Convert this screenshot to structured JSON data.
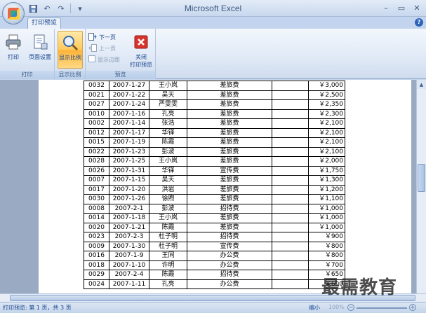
{
  "window": {
    "title": "Microsoft Excel",
    "controls": [
      "–",
      "▭",
      "✕"
    ]
  },
  "tabs": {
    "active": "打印预览",
    "help": "?"
  },
  "ribbon": {
    "groups": [
      {
        "label": "打印",
        "buttons": [
          "打印",
          "页面设置"
        ]
      },
      {
        "label": "显示比例",
        "buttons": [
          "显示比例"
        ]
      },
      {
        "label": "预览",
        "small_buttons": [
          "下一页",
          "上一页",
          "显示边距"
        ],
        "big_button": "关闭\n打印预览"
      }
    ],
    "close_line1": "关闭",
    "close_line2": "打印预览"
  },
  "table": {
    "rows": [
      [
        "0032",
        "2007-1-27",
        "王小岚",
        "差旅费",
        "",
        "￥3,000"
      ],
      [
        "0021",
        "2007-1-22",
        "吴天",
        "差旅费",
        "",
        "￥2,500"
      ],
      [
        "0027",
        "2007-1-24",
        "严雯雯",
        "差旅费",
        "",
        "￥2,350"
      ],
      [
        "0010",
        "2007-1-16",
        "孔亮",
        "差旅费",
        "",
        "￥2,300"
      ],
      [
        "0002",
        "2007-1-14",
        "张浩",
        "差旅费",
        "",
        "￥2,100"
      ],
      [
        "0012",
        "2007-1-17",
        "华铎",
        "差旅费",
        "",
        "￥2,100"
      ],
      [
        "0015",
        "2007-1-19",
        "陈霞",
        "差旅费",
        "",
        "￥2,100"
      ],
      [
        "0022",
        "2007-1-23",
        "彭波",
        "差旅费",
        "",
        "￥2,100"
      ],
      [
        "0028",
        "2007-1-25",
        "王小岚",
        "差旅费",
        "",
        "￥2,000"
      ],
      [
        "0026",
        "2007-1-31",
        "华铎",
        "宣传费",
        "",
        "￥1,750"
      ],
      [
        "0007",
        "2007-1-15",
        "吴天",
        "差旅费",
        "",
        "￥1,300"
      ],
      [
        "0017",
        "2007-1-20",
        "洪岩",
        "差旅费",
        "",
        "￥1,200"
      ],
      [
        "0030",
        "2007-1-26",
        "徐煦",
        "差旅费",
        "",
        "￥1,100"
      ],
      [
        "0008",
        "2007-2-1",
        "彭波",
        "招待费",
        "",
        "￥1,000"
      ],
      [
        "0014",
        "2007-1-18",
        "王小岚",
        "差旅费",
        "",
        "￥1,000"
      ],
      [
        "0020",
        "2007-1-21",
        "陈霞",
        "差旅费",
        "",
        "￥1,000"
      ],
      [
        "0023",
        "2007-2-3",
        "杜子明",
        "招待费",
        "",
        "￥900"
      ],
      [
        "0009",
        "2007-1-30",
        "杜子明",
        "宣传费",
        "",
        "￥800"
      ],
      [
        "0016",
        "2007-1-9",
        "王同",
        "办公费",
        "",
        "￥800"
      ],
      [
        "0018",
        "2007-1-10",
        "许明",
        "办公费",
        "",
        "￥700"
      ],
      [
        "0029",
        "2007-2-4",
        "陈霞",
        "招待费",
        "",
        "￥650"
      ],
      [
        "0024",
        "2007-1-11",
        "孔亮",
        "办公费",
        "",
        "￥600"
      ]
    ]
  },
  "status": {
    "page_info": "打印预览: 第 1 页，共 3 页",
    "zoom_label": "缩小",
    "zoom_pct": "100%"
  },
  "watermark": "最需教育"
}
